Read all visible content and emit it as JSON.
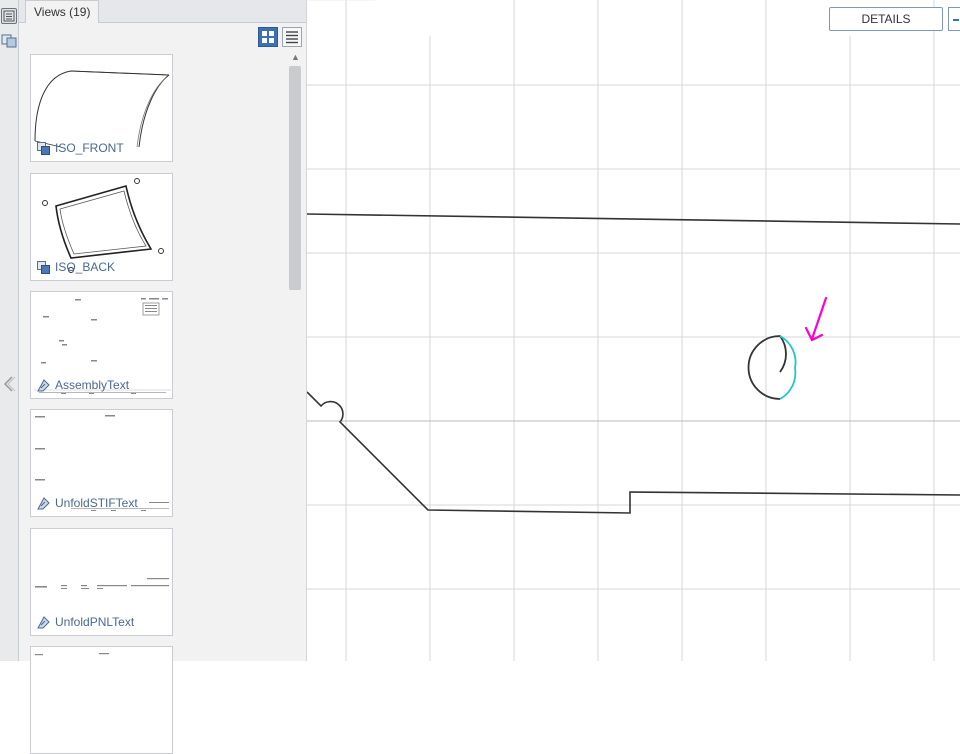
{
  "panel": {
    "tab_title": "Views (19)",
    "views": [
      {
        "label": "ISO_FRONT",
        "icon": "view-3d-icon"
      },
      {
        "label": "ISO_BACK",
        "icon": "view-3d-icon"
      },
      {
        "label": "AssemblyText",
        "icon": "text-view-icon"
      },
      {
        "label": "UnfoldSTIFText",
        "icon": "text-view-icon"
      },
      {
        "label": "UnfoldPNLText",
        "icon": "text-view-icon"
      }
    ]
  },
  "canvas": {
    "details_button": "DETAILS"
  },
  "colors": {
    "selected_arc": "#1fc6cf",
    "annotation_arrow": "#ff00cc",
    "accent": "#3b6fb6"
  }
}
